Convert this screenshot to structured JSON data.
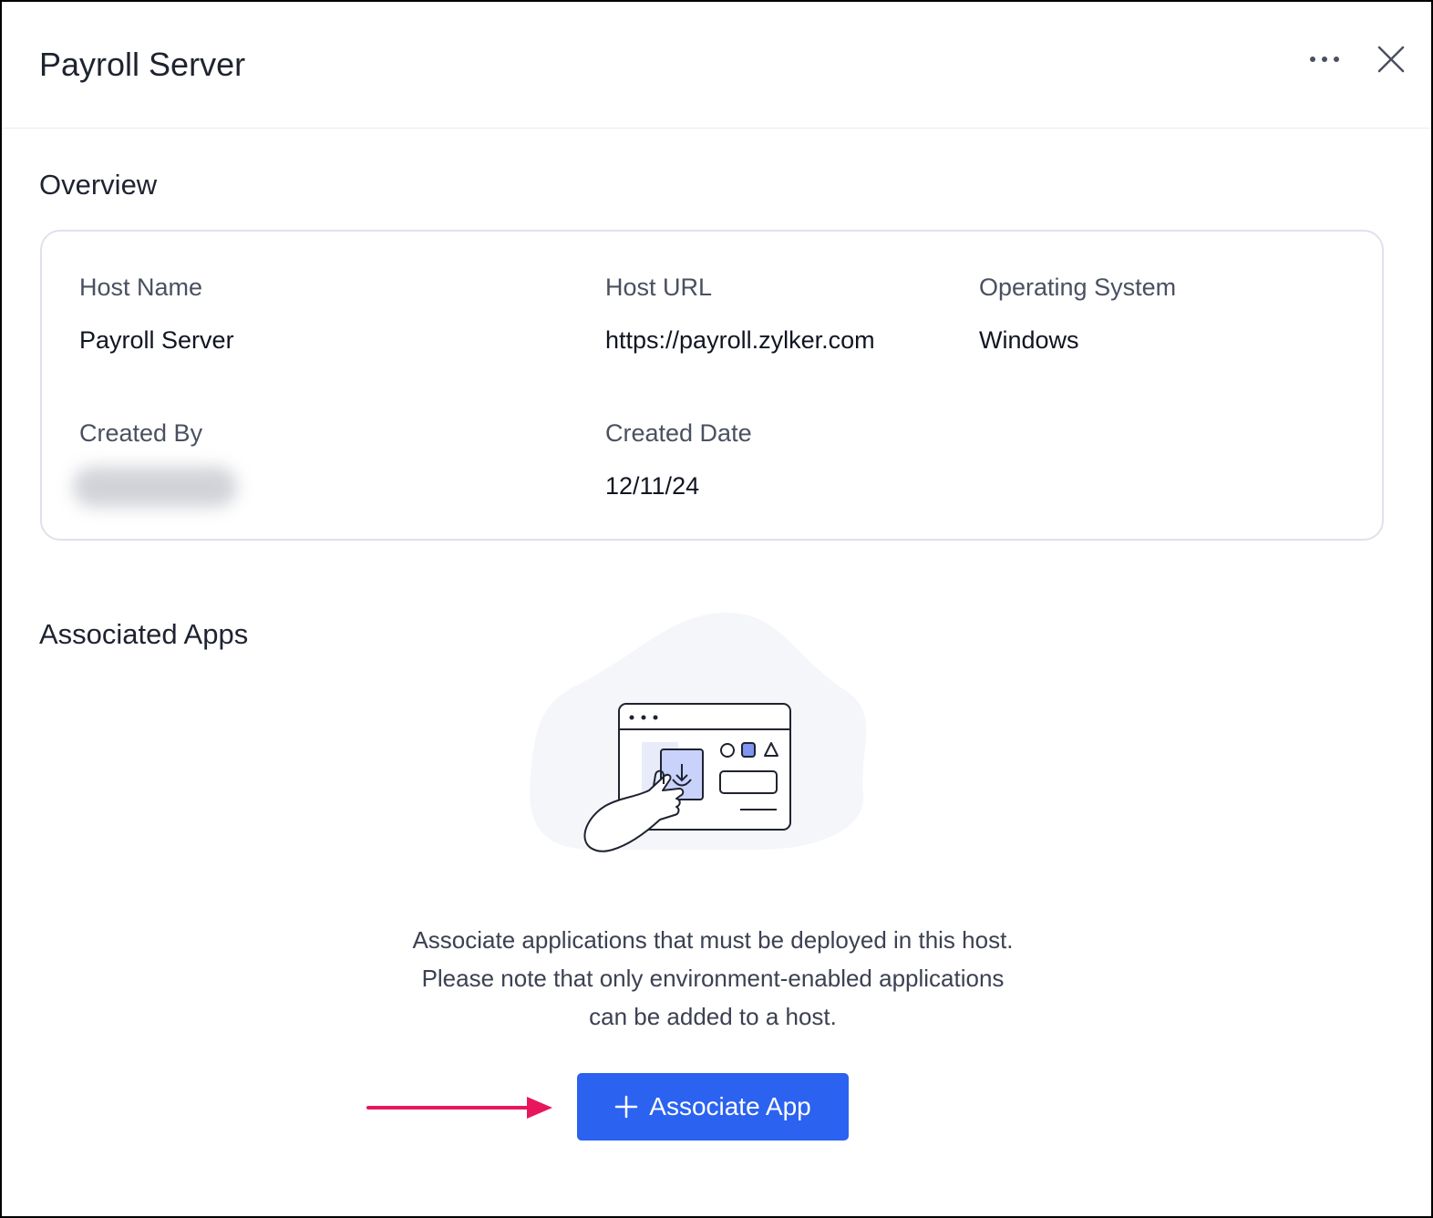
{
  "header": {
    "title": "Payroll Server",
    "more_icon": "more-horizontal-icon",
    "close_icon": "close-icon"
  },
  "overview": {
    "title": "Overview",
    "fields": {
      "host_name": {
        "label": "Host Name",
        "value": "Payroll Server"
      },
      "host_url": {
        "label": "Host URL",
        "value": "https://payroll.zylker.com"
      },
      "operating_system": {
        "label": "Operating System",
        "value": "Windows"
      },
      "created_by": {
        "label": "Created By"
      },
      "created_date": {
        "label": "Created Date",
        "value": "12/11/24"
      }
    }
  },
  "associated_apps": {
    "title": "Associated Apps",
    "empty_message": {
      "line1": "Associate applications that must be deployed in this host.",
      "line2": "Please note that only environment-enabled applications",
      "line3": "can be added to a host."
    },
    "button_label": "Associate App",
    "button_icon": "plus-icon"
  },
  "colors": {
    "primary": "#2b62f0",
    "annotation_arrow": "#e8175d",
    "card_border": "#dfe2ea"
  }
}
